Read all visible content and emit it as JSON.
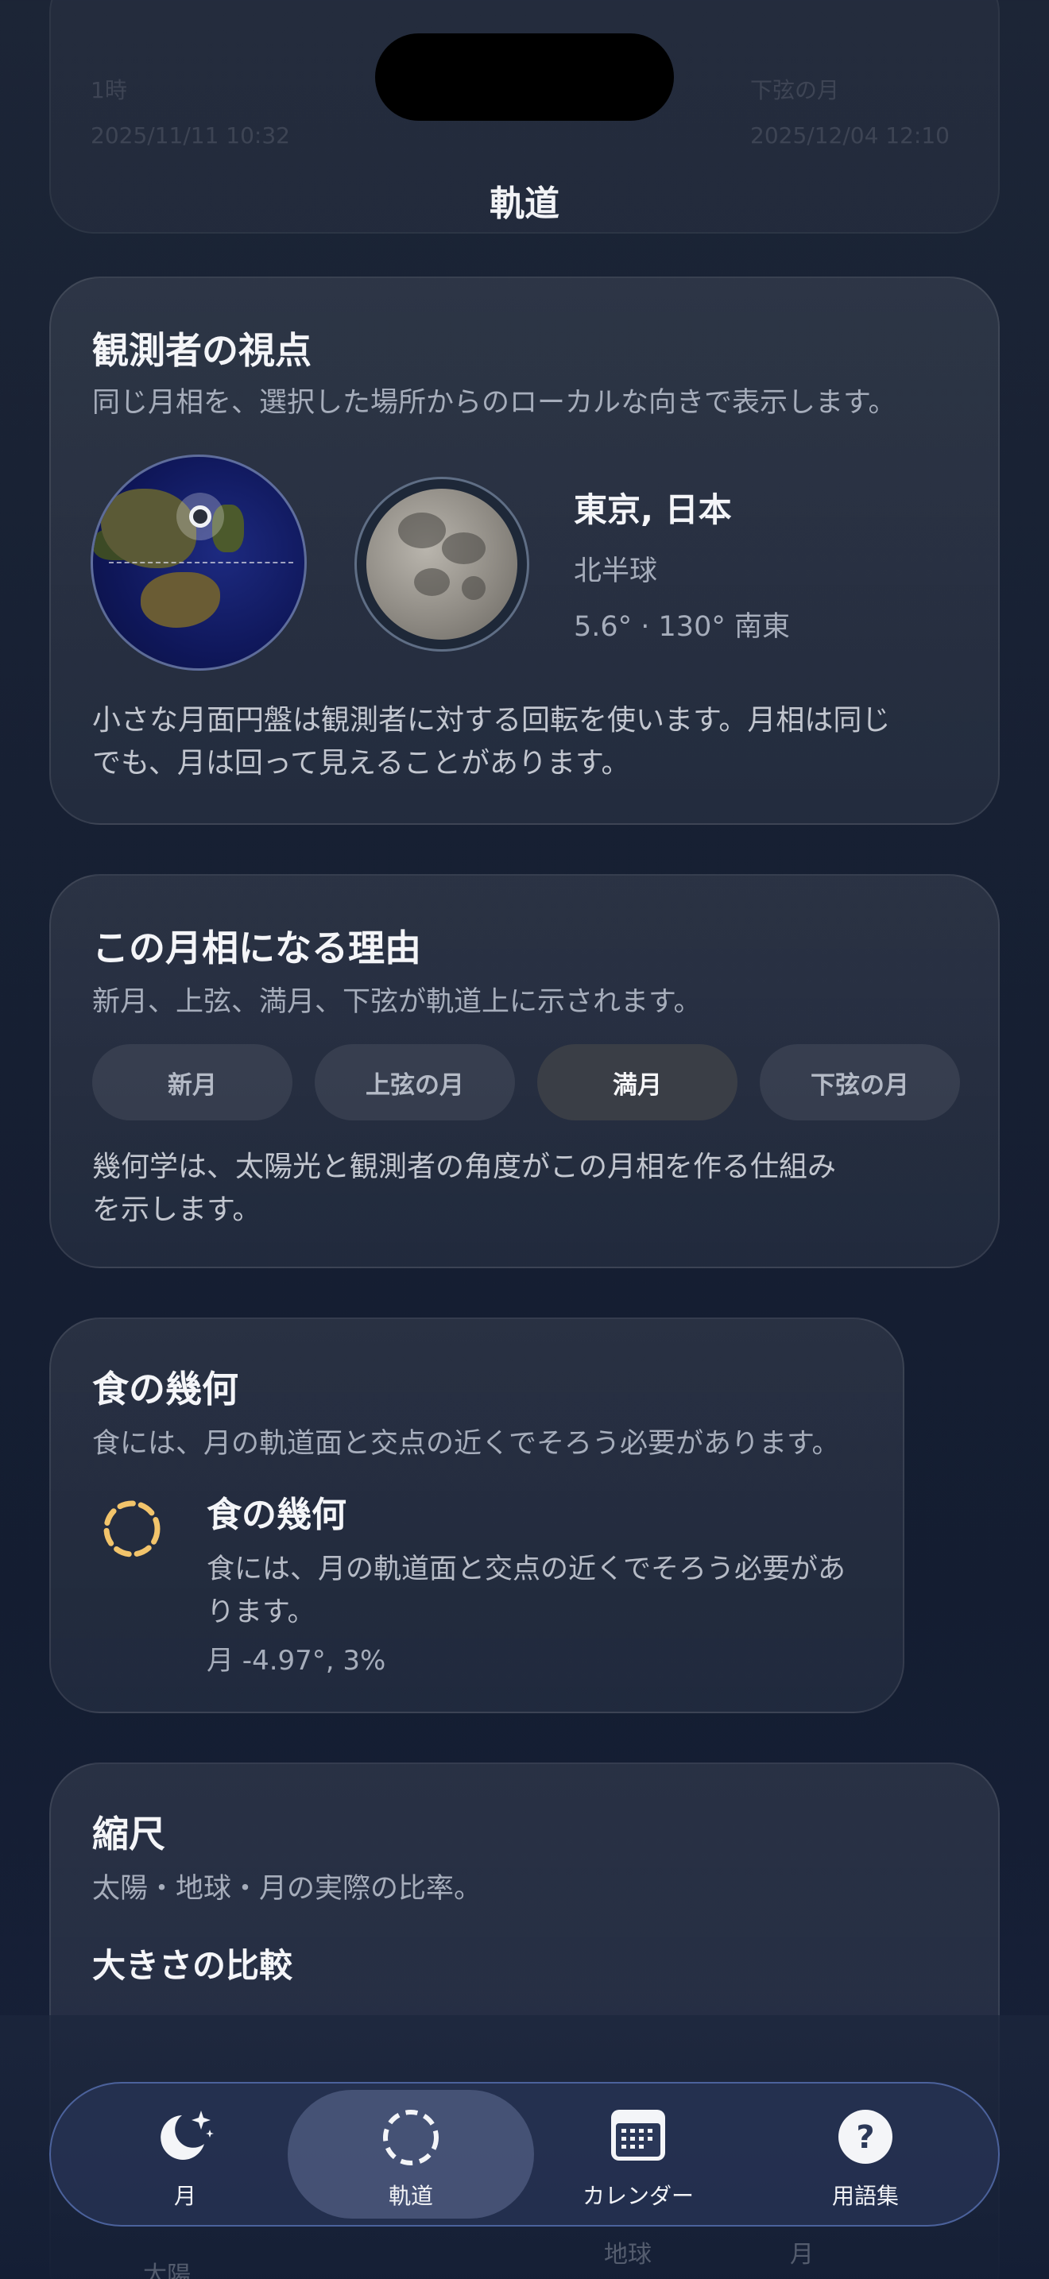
{
  "header": {
    "title": "軌道",
    "behind_cards": [
      "1時",
      "2025/11/11 10:32",
      "下弦の月",
      "2025/12/04 12:10"
    ]
  },
  "observer": {
    "title": "観測者の視点",
    "subtitle": "同じ月相を、選択した場所からのローカルな向きで表示します。",
    "location": "東京, 日本",
    "hemisphere": "北半球",
    "position": "5.6° · 130° 南東",
    "note_line1": "小さな月面円盤は観測者に対する回転を使います。月相は同じ",
    "note_line2": "でも、月は回って見えることがあります。"
  },
  "phase_reason": {
    "title": "この月相になる理由",
    "subtitle": "新月、上弦、満月、下弦が軌道上に示されます。",
    "phases": [
      {
        "label": "新月",
        "active": false
      },
      {
        "label": "上弦の月",
        "active": false
      },
      {
        "label": "満月",
        "active": true
      },
      {
        "label": "下弦の月",
        "active": false
      }
    ],
    "note_line1": "幾何学は、太陽光と観測者の角度がこの月相を作る仕組み",
    "note_line2": "を示します。"
  },
  "eclipse": {
    "title": "食の幾何",
    "subtitle": "食には、月の軌道面と交点の近くでそろう必要があります。",
    "item_title": "食の幾何",
    "item_desc": "食には、月の軌道面と交点の近くでそろう必要があります。",
    "item_value": "月 -4.97°, 3%",
    "icon_color": "#f2c46b"
  },
  "scale": {
    "title": "縮尺",
    "subtitle": "太陽・地球・月の実際の比率。",
    "section_title": "大きさの比較",
    "under_labels": [
      "太陽",
      "地球",
      "月"
    ]
  },
  "tabbar": {
    "active": "orbit",
    "tabs": [
      {
        "id": "moon",
        "label": "月",
        "icon": "moon-stars-icon"
      },
      {
        "id": "orbit",
        "label": "軌道",
        "icon": "dashed-circle-icon"
      },
      {
        "id": "calendar",
        "label": "カレンダー",
        "icon": "calendar-icon"
      },
      {
        "id": "glossary",
        "label": "用語集",
        "icon": "question-circle-icon"
      }
    ]
  }
}
